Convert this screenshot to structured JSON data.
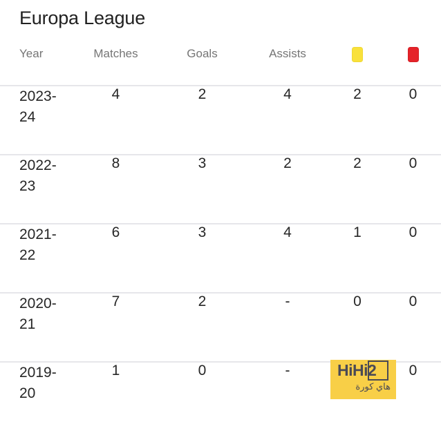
{
  "page": {
    "title": "Europa League",
    "background_color": "#ffffff",
    "title_color": "#212121",
    "divider_color": "#E6E6EA",
    "header_text_color": "#757575",
    "body_text_color": "#262626"
  },
  "table": {
    "columns": [
      {
        "key": "year",
        "label": "Year",
        "type": "text"
      },
      {
        "key": "matches",
        "label": "Matches",
        "type": "text"
      },
      {
        "key": "goals",
        "label": "Goals",
        "type": "text"
      },
      {
        "key": "assists",
        "label": "Assists",
        "type": "text"
      },
      {
        "key": "yellow",
        "label": "",
        "type": "icon",
        "icon": "yellow-card-icon",
        "color": "#F9E13B"
      },
      {
        "key": "red",
        "label": "",
        "type": "icon",
        "icon": "red-card-icon",
        "color": "#E52329"
      }
    ],
    "rows": [
      {
        "year": "2023-24",
        "matches": "4",
        "goals": "2",
        "assists": "4",
        "yellow": "2",
        "red": "0"
      },
      {
        "year": "2022-23",
        "matches": "8",
        "goals": "3",
        "assists": "2",
        "yellow": "2",
        "red": "0"
      },
      {
        "year": "2021-22",
        "matches": "6",
        "goals": "3",
        "assists": "4",
        "yellow": "1",
        "red": "0"
      },
      {
        "year": "2020-21",
        "matches": "7",
        "goals": "2",
        "assists": "-",
        "yellow": "0",
        "red": "0"
      },
      {
        "year": "2019-20",
        "matches": "1",
        "goals": "0",
        "assists": "-",
        "yellow": "",
        "red": "0"
      }
    ]
  },
  "watermark": {
    "main_text": "HiHi2",
    "sub_text": "هاي كورة",
    "background_color": "#F8CF47",
    "text_color": "#4A4A55"
  }
}
